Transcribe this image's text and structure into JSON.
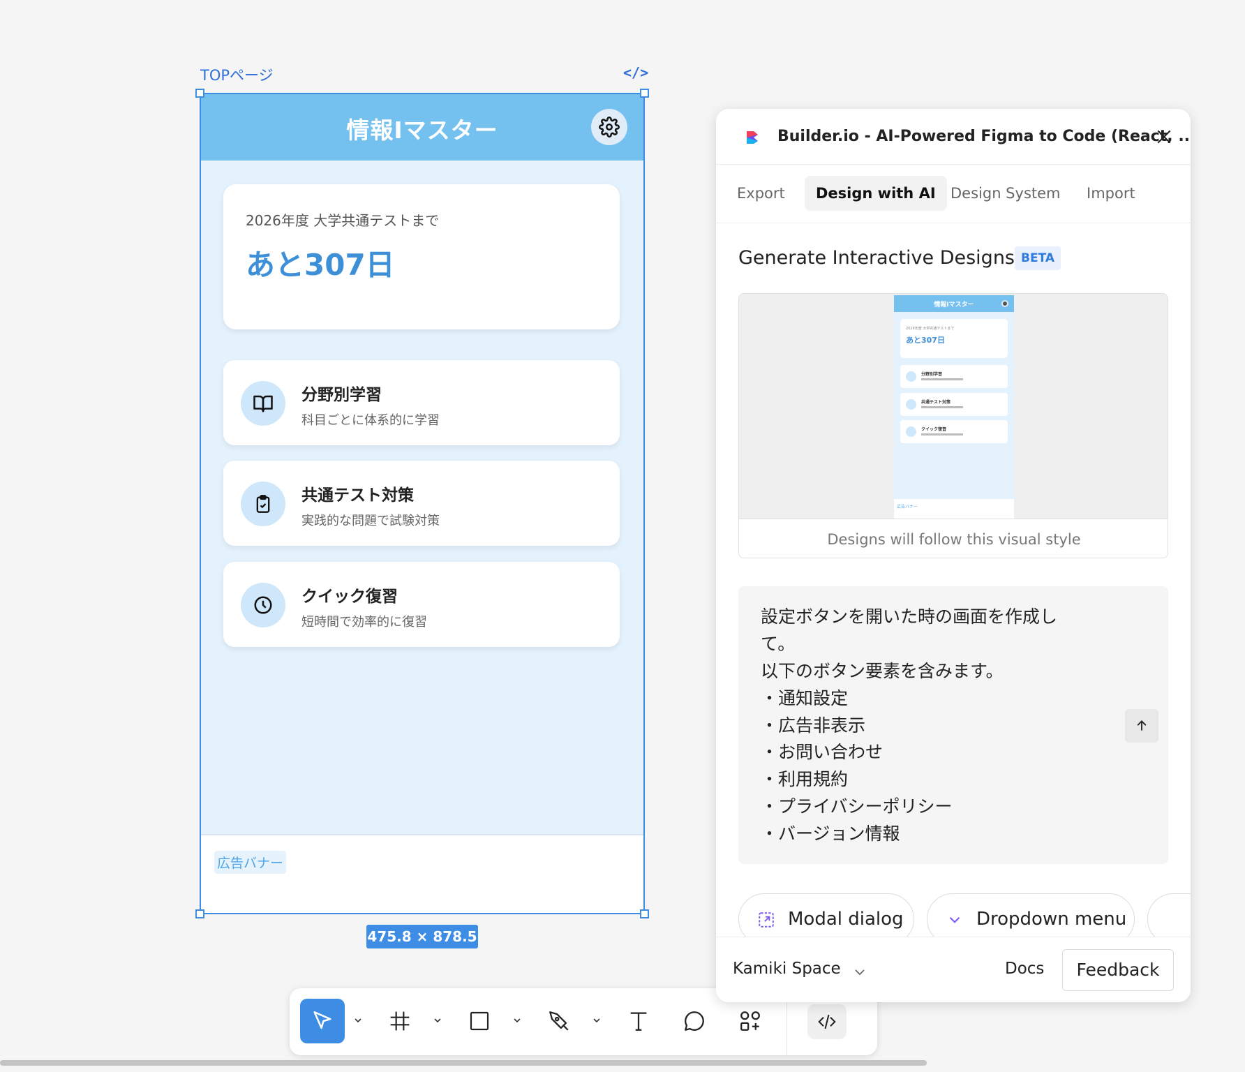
{
  "frame": {
    "label": "TOPページ",
    "code_glyph": "</>",
    "size_badge": "475.8 × 878.5"
  },
  "app": {
    "title": "情報Iマスター",
    "countdown": {
      "label": "2026年度 大学共通テストまで",
      "days": "あと307日"
    },
    "menu": [
      {
        "title": "分野別学習",
        "subtitle": "科目ごとに体系的に学習",
        "icon": "book-icon"
      },
      {
        "title": "共通テスト対策",
        "subtitle": "実践的な問題で試験対策",
        "icon": "clipboard-check-icon"
      },
      {
        "title": "クイック復習",
        "subtitle": "短時間で効率的に復習",
        "icon": "clock-icon"
      }
    ],
    "ad_label": "広告バナー",
    "colors": {
      "header": "#74c0ef",
      "background": "#e4f2fd",
      "accent": "#3d8fd8"
    }
  },
  "plugin": {
    "title": "Builder.io - AI-Powered Figma to Code (React, ...",
    "tabs": [
      {
        "label": "Export",
        "active": false
      },
      {
        "label": "Design with AI",
        "active": true
      },
      {
        "label": "Design System",
        "active": false
      },
      {
        "label": "Import",
        "active": false
      }
    ],
    "section_title": "Generate Interactive Designs",
    "beta_badge": "BETA",
    "style_caption": "Designs will follow this visual style",
    "preview": {
      "title": "情報Iマスター",
      "cd_label": "2026年度 大学共通テストまで",
      "cd_days": "あと307日",
      "items": [
        "分野別学習",
        "共通テスト対策",
        "クイック復習"
      ],
      "ad_label": "広告バナー"
    },
    "prompt_lines": [
      "設定ボタンを開いた時の画面を作成し",
      "て。",
      "以下のボタン要素を含みます。",
      "・通知設定",
      "・広告非表示",
      "・お問い合わせ",
      "・利用規約",
      "・プライバシーポリシー",
      "・バージョン情報"
    ],
    "chips": [
      {
        "label": "Modal dialog",
        "icon": "modal-icon"
      },
      {
        "label": "Dropdown menu",
        "icon": "chevron-down-icon"
      }
    ],
    "footer": {
      "workspace": "Kamiki Space",
      "docs": "Docs",
      "feedback": "Feedback"
    }
  },
  "toolbar": {
    "tools": [
      "move-tool",
      "frame-tool",
      "rectangle-tool",
      "pen-tool",
      "text-tool",
      "comment-tool",
      "assets-tool",
      "dev-mode-toggle"
    ],
    "active": "move-tool"
  }
}
